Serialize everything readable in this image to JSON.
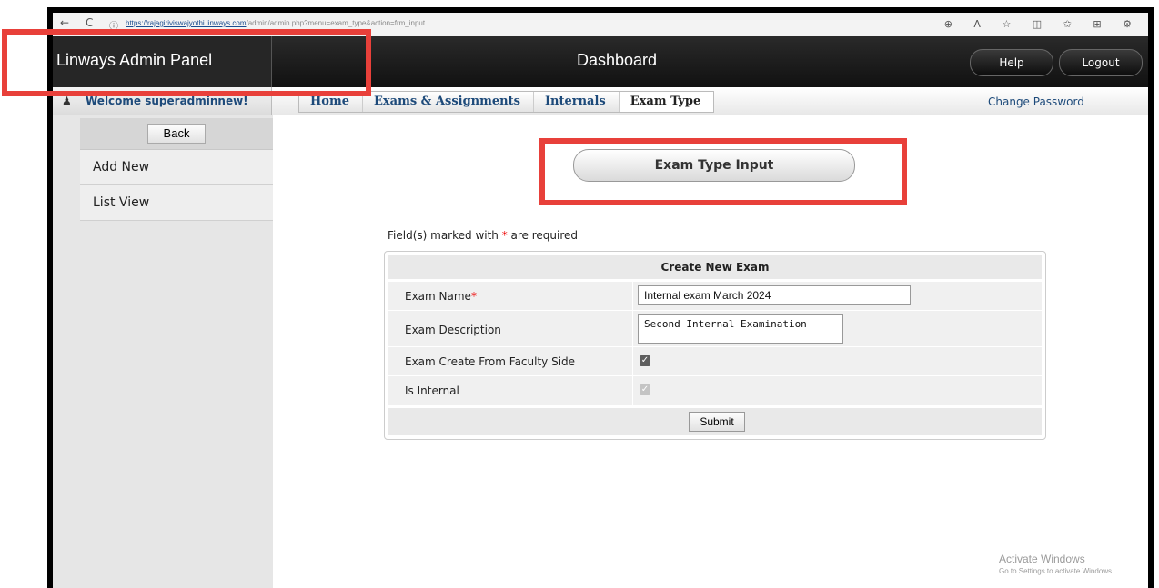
{
  "browser": {
    "url_host": "https://rajagiriviswajyothi.linways.com",
    "url_path": "/admin/admin.php?menu=exam_type&action=frm_input",
    "back": "←",
    "refresh": "C",
    "lock": "ⓘ",
    "icons": "⊕ A ☆ ◫ ✩ ⊞ ⚙"
  },
  "header": {
    "brand": "Linways Admin Panel",
    "title": "Dashboard",
    "help": "Help",
    "logout": "Logout"
  },
  "subbar": {
    "welcome": "Welcome superadminnew!",
    "user_icon": "user-icon",
    "change_password": "Change Password"
  },
  "breadcrumb": [
    "Home",
    "Exams & Assignments",
    "Internals",
    "Exam Type"
  ],
  "sidebar": {
    "back": "Back",
    "items": [
      {
        "label": "Add New"
      },
      {
        "label": "List View"
      }
    ]
  },
  "main": {
    "section_title": "Exam Type Input",
    "required_note_pre": "Field(s) marked with ",
    "required_star": "*",
    "required_note_post": " are required"
  },
  "form": {
    "title": "Create New Exam",
    "exam_name_label": "Exam Name",
    "exam_name_value": "Internal exam March 2024",
    "exam_description_label": "Exam Description",
    "exam_description_value": "Second Internal Examination",
    "faculty_side_label": "Exam Create From Faculty Side",
    "faculty_side_checked": true,
    "is_internal_label": "Is Internal",
    "is_internal_checked": true,
    "submit": "Submit"
  },
  "watermark": {
    "line1": "Activate Windows",
    "line2": "Go to Settings to activate Windows."
  },
  "colors": {
    "annotation": "#e8403a",
    "link": "#1d4a7a",
    "required": "#ee0000"
  }
}
